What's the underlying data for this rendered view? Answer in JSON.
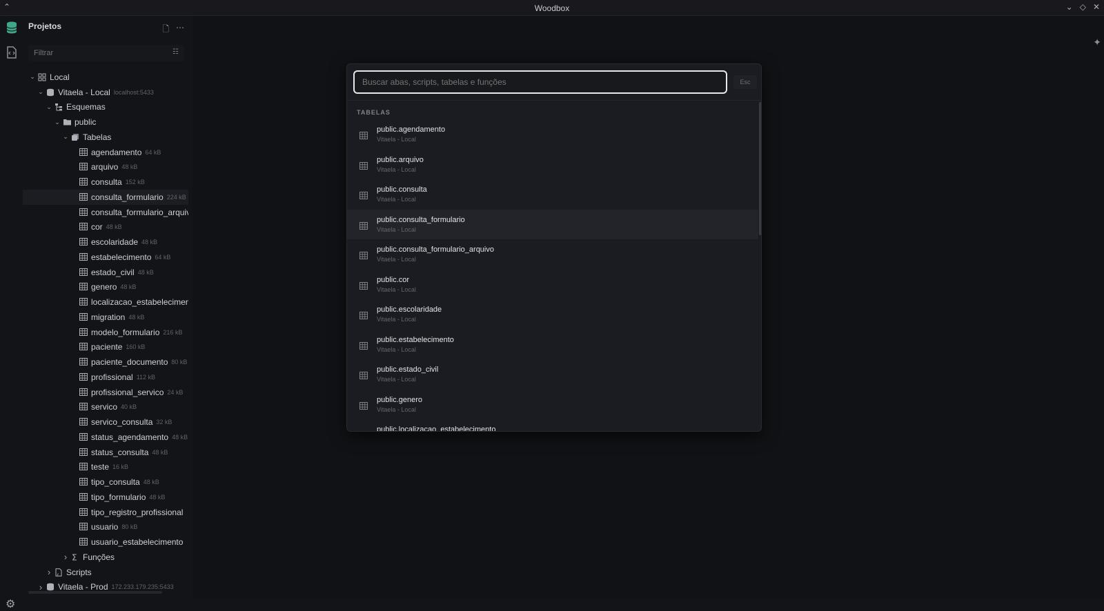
{
  "window": {
    "title": "Woodbox"
  },
  "sidebar": {
    "title": "Projetos",
    "filter_placeholder": "Filtrar",
    "tree": [
      {
        "label": "Local",
        "depth": 0,
        "chevron": "down",
        "icon": "grid-icon"
      },
      {
        "label": "Vitaela - Local",
        "extra": "localhost:5433",
        "depth": 1,
        "chevron": "down",
        "icon": "database-icon"
      },
      {
        "label": "Esquemas",
        "depth": 2,
        "chevron": "down",
        "icon": "schema-icon"
      },
      {
        "label": "public",
        "depth": 3,
        "chevron": "down",
        "icon": "folder-icon"
      },
      {
        "label": "Tabelas",
        "depth": 4,
        "chevron": "down",
        "icon": "tables-icon"
      },
      {
        "label": "agendamento",
        "extra": "64 kB",
        "depth": 5,
        "icon": "table-icon"
      },
      {
        "label": "arquivo",
        "extra": "48 kB",
        "depth": 5,
        "icon": "table-icon"
      },
      {
        "label": "consulta",
        "extra": "152 kB",
        "depth": 5,
        "icon": "table-icon"
      },
      {
        "label": "consulta_formulario",
        "extra": "224 kB",
        "depth": 5,
        "icon": "table-icon",
        "selected": true
      },
      {
        "label": "consulta_formulario_arquivo",
        "depth": 5,
        "icon": "table-icon"
      },
      {
        "label": "cor",
        "extra": "48 kB",
        "depth": 5,
        "icon": "table-icon"
      },
      {
        "label": "escolaridade",
        "extra": "48 kB",
        "depth": 5,
        "icon": "table-icon"
      },
      {
        "label": "estabelecimento",
        "extra": "64 kB",
        "depth": 5,
        "icon": "table-icon"
      },
      {
        "label": "estado_civil",
        "extra": "48 kB",
        "depth": 5,
        "icon": "table-icon"
      },
      {
        "label": "genero",
        "extra": "48 kB",
        "depth": 5,
        "icon": "table-icon"
      },
      {
        "label": "localizacao_estabelecimento",
        "depth": 5,
        "icon": "table-icon"
      },
      {
        "label": "migration",
        "extra": "48 kB",
        "depth": 5,
        "icon": "table-icon"
      },
      {
        "label": "modelo_formulario",
        "extra": "216 kB",
        "depth": 5,
        "icon": "table-icon"
      },
      {
        "label": "paciente",
        "extra": "160 kB",
        "depth": 5,
        "icon": "table-icon"
      },
      {
        "label": "paciente_documento",
        "extra": "80 kB",
        "depth": 5,
        "icon": "table-icon"
      },
      {
        "label": "profissional",
        "extra": "112 kB",
        "depth": 5,
        "icon": "table-icon"
      },
      {
        "label": "profissional_servico",
        "extra": "24 kB",
        "depth": 5,
        "icon": "table-icon"
      },
      {
        "label": "servico",
        "extra": "40 kB",
        "depth": 5,
        "icon": "table-icon"
      },
      {
        "label": "servico_consulta",
        "extra": "32 kB",
        "depth": 5,
        "icon": "table-icon"
      },
      {
        "label": "status_agendamento",
        "extra": "48 kB",
        "depth": 5,
        "icon": "table-icon"
      },
      {
        "label": "status_consulta",
        "extra": "48 kB",
        "depth": 5,
        "icon": "table-icon"
      },
      {
        "label": "teste",
        "extra": "16 kB",
        "depth": 5,
        "icon": "table-icon"
      },
      {
        "label": "tipo_consulta",
        "extra": "48 kB",
        "depth": 5,
        "icon": "table-icon"
      },
      {
        "label": "tipo_formulario",
        "extra": "48 kB",
        "depth": 5,
        "icon": "table-icon"
      },
      {
        "label": "tipo_registro_profissional",
        "depth": 5,
        "icon": "table-icon"
      },
      {
        "label": "usuario",
        "extra": "80 kB",
        "depth": 5,
        "icon": "table-icon"
      },
      {
        "label": "usuario_estabelecimento",
        "depth": 5,
        "icon": "table-icon"
      },
      {
        "label": "Funções",
        "depth": 4,
        "chevron": "right",
        "icon": "sigma-icon"
      },
      {
        "label": "Scripts",
        "depth": 2,
        "chevron": "right",
        "icon": "script-icon"
      },
      {
        "label": "Vitaela - Prod",
        "extra": "172.233.179.235:5433",
        "depth": 1,
        "chevron": "right",
        "icon": "database-icon"
      }
    ]
  },
  "palette": {
    "search_placeholder": "Buscar abas, scripts, tabelas e funções",
    "esc_label": "Esc",
    "section_title": "TABELAS",
    "results": [
      {
        "name": "public.agendamento",
        "source": "Vitaela - Local"
      },
      {
        "name": "public.arquivo",
        "source": "Vitaela - Local"
      },
      {
        "name": "public.consulta",
        "source": "Vitaela - Local"
      },
      {
        "name": "public.consulta_formulario",
        "source": "Vitaela - Local",
        "active": true
      },
      {
        "name": "public.consulta_formulario_arquivo",
        "source": "Vitaela - Local"
      },
      {
        "name": "public.cor",
        "source": "Vitaela - Local"
      },
      {
        "name": "public.escolaridade",
        "source": "Vitaela - Local"
      },
      {
        "name": "public.estabelecimento",
        "source": "Vitaela - Local"
      },
      {
        "name": "public.estado_civil",
        "source": "Vitaela - Local"
      },
      {
        "name": "public.genero",
        "source": "Vitaela - Local"
      },
      {
        "name": "public.localizacao_estabelecimento",
        "source": ""
      }
    ]
  },
  "colors": {
    "accent": "#3fa88a",
    "background": "#131417",
    "panel": "#1b1c21"
  }
}
